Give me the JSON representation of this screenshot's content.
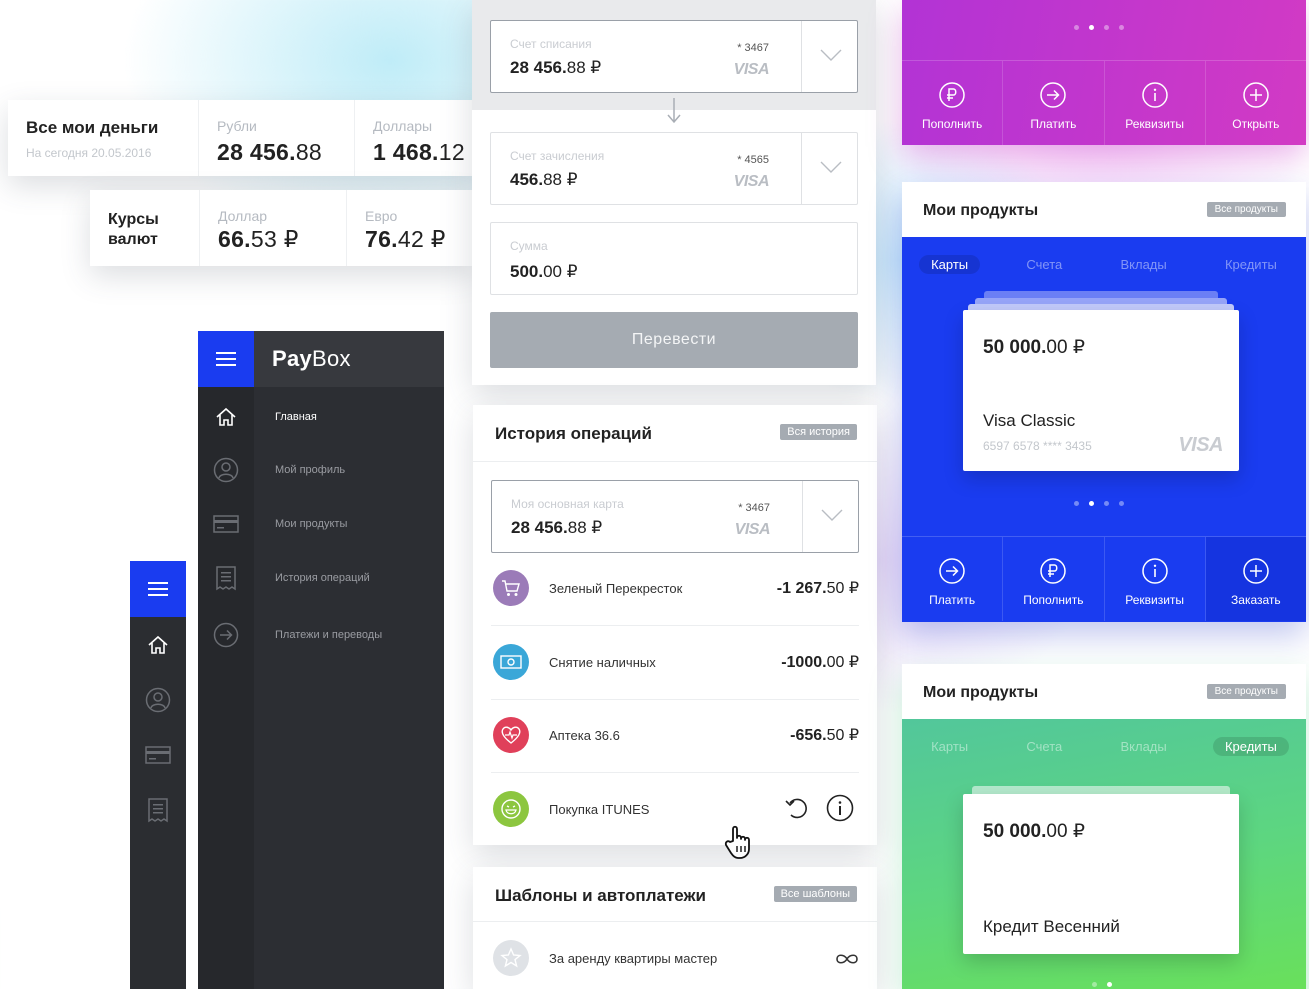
{
  "summary": {
    "title": "Все мои деньги",
    "date": "На сегодня 20.05.2016",
    "rub_label": "Рубли",
    "rub_int": "28 456.",
    "rub_cents": "88",
    "usd_label": "Доллары",
    "usd_int": "1 468.",
    "usd_cents": "12"
  },
  "rates": {
    "title_1": "Курсы",
    "title_2": "валют",
    "dollar_label": "Доллар",
    "dollar_int": "66.",
    "dollar_cents": "53 ₽",
    "euro_label": "Евро",
    "euro_int": "76.",
    "euro_cents": "42 ₽"
  },
  "sidebar": {
    "brand_bold": "Pay",
    "brand_rest": "Box",
    "items": [
      {
        "label": "Главная",
        "icon": "home-icon"
      },
      {
        "label": "Мой профиль",
        "icon": "profile-icon"
      },
      {
        "label": "Мои продукты",
        "icon": "card-icon"
      },
      {
        "label": "История операций",
        "icon": "receipt-icon"
      },
      {
        "label": "Платежи и переводы",
        "icon": "arrow-right-circle-icon"
      }
    ]
  },
  "transfer": {
    "from": {
      "label": "Счет списания",
      "int": "28 456.",
      "cents": "88 ₽",
      "number": "* 3467",
      "brand": "VISA"
    },
    "to": {
      "label": "Счет зачисления",
      "int": "456.",
      "cents": "88 ₽",
      "number": "* 4565",
      "brand": "VISA"
    },
    "sum": {
      "label": "Сумма",
      "int": "500.",
      "cents": "00 ₽"
    },
    "button": "Перевести"
  },
  "history": {
    "title": "История операций",
    "badge": "Вся история",
    "card": {
      "label": "Моя основная карта",
      "int": "28 456.",
      "cents": "88 ₽",
      "number": "* 3467",
      "brand": "VISA"
    },
    "ops": [
      {
        "name": "Зеленый Перекресток",
        "amt_int": "-1 267.",
        "amt_cents": "50 ₽",
        "color": "#9b7bb8",
        "icon": "cart-icon"
      },
      {
        "name": "Снятие наличных",
        "amt_int": "-1000.",
        "amt_cents": "00 ₽",
        "color": "#3aa7d8",
        "icon": "cash-icon"
      },
      {
        "name": "Аптека 36.6",
        "amt_int": "-656.",
        "amt_cents": "50 ₽",
        "color": "#e0405a",
        "icon": "heart-pulse-icon"
      },
      {
        "name": "Покупка ITUNES",
        "amt_int": "",
        "amt_cents": "",
        "color": "#8cc63f",
        "icon": "smile-icon"
      }
    ]
  },
  "templates": {
    "title": "Шаблоны и автоплатежи",
    "badge": "Все шаблоны",
    "item": "За аренду квартиры мастер"
  },
  "purple_panel": {
    "actions": [
      "Пополнить",
      "Платить",
      "Реквизиты",
      "Открыть"
    ]
  },
  "products_blue": {
    "title": "Мои продукты",
    "badge": "Все продукты",
    "tabs": [
      "Карты",
      "Счета",
      "Вклады",
      "Кредиты"
    ],
    "active_tab": "Карты",
    "card_int": "50 000.",
    "card_cents": "00 ₽",
    "card_name": "Visa Classic",
    "card_number": "6597 6578 **** 3435",
    "card_brand": "VISA",
    "actions": [
      "Платить",
      "Пополнить",
      "Реквизиты",
      "Заказать"
    ],
    "color": "#1a3cf0"
  },
  "products_green": {
    "title": "Мои продукты",
    "badge": "Все продукты",
    "tabs": [
      "Карты",
      "Счета",
      "Вклады",
      "Кредиты"
    ],
    "active_tab": "Кредиты",
    "card_int": "50 000.",
    "card_cents": "00 ₽",
    "card_name": "Кредит Весенний"
  }
}
